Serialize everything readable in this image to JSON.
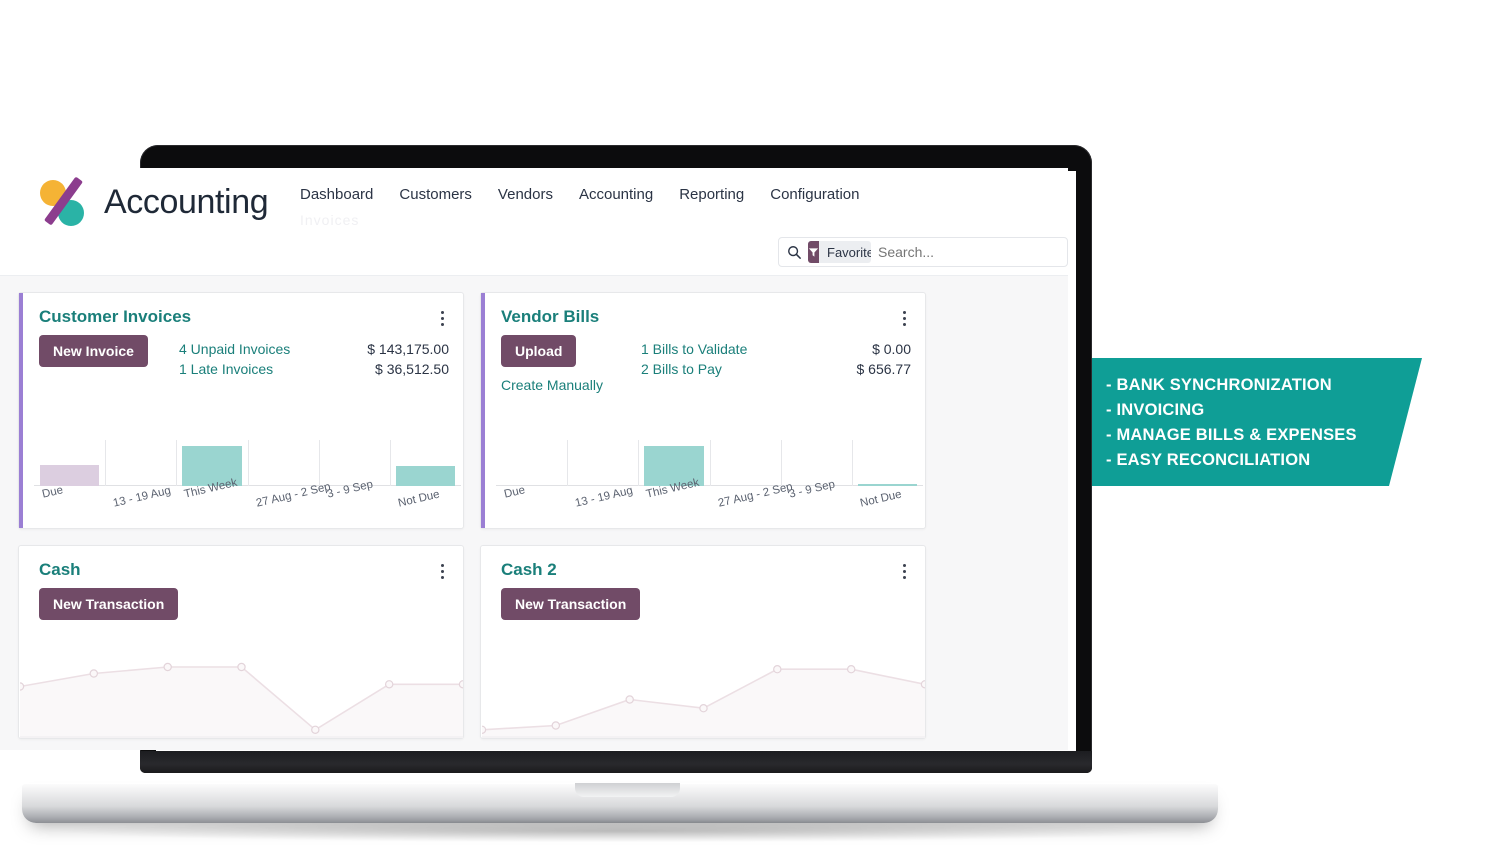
{
  "app": {
    "brand_name": "Accounting",
    "ghost_text": "Invoices",
    "nav": [
      {
        "label": "Dashboard"
      },
      {
        "label": "Customers"
      },
      {
        "label": "Vendors"
      },
      {
        "label": "Accounting"
      },
      {
        "label": "Reporting"
      },
      {
        "label": "Configuration"
      }
    ],
    "search": {
      "facet_label": "Favorites",
      "facet_remove": "×",
      "placeholder": "Search..."
    }
  },
  "cards": {
    "customer_invoices": {
      "title": "Customer Invoices",
      "button": "New Invoice",
      "stats": [
        {
          "label": "4 Unpaid Invoices",
          "value": "$ 143,175.00"
        },
        {
          "label": "1 Late Invoices",
          "value": "$ 36,512.50"
        }
      ]
    },
    "vendor_bills": {
      "title": "Vendor Bills",
      "button": "Upload",
      "secondary_link": "Create Manually",
      "stats": [
        {
          "label": "1 Bills to Validate",
          "value": "$ 0.00"
        },
        {
          "label": "2 Bills to Pay",
          "value": "$ 656.77"
        }
      ]
    },
    "cash": {
      "title": "Cash",
      "button": "New Transaction"
    },
    "cash_2": {
      "title": "Cash 2",
      "button": "New Transaction"
    }
  },
  "banner": {
    "items": [
      "- BANK SYNCHRONIZATION",
      "- INVOICING",
      "- MANAGE BILLS & EXPENSES",
      "- EASY RECONCILIATION"
    ],
    "color": "#0f9e96"
  },
  "colors": {
    "accent_purple": "#714B67",
    "card_border_purple": "#9b7fd4",
    "title_teal": "#1a7f7a",
    "bar_teal": "#9ad5d0",
    "bar_mauve": "#dccee0",
    "line_pink": "#e7dbe0"
  },
  "chart_data": [
    {
      "type": "bar",
      "title": "Customer Invoices",
      "categories": [
        "Due",
        "13 - 19 Aug",
        "This Week",
        "27 Aug - 2 Sep",
        "3 - 9 Sep",
        "Not Due"
      ],
      "values": [
        14,
        0,
        26,
        0,
        0,
        13
      ],
      "colors": [
        "#dccee0",
        null,
        "#9ad5d0",
        null,
        null,
        "#9ad5d0"
      ],
      "xlabel": "",
      "ylabel": "",
      "ylim": [
        0,
        30
      ],
      "grid": true,
      "legend": false
    },
    {
      "type": "bar",
      "title": "Vendor Bills",
      "categories": [
        "Due",
        "13 - 19 Aug",
        "This Week",
        "27 Aug - 2 Sep",
        "3 - 9 Sep",
        "Not Due"
      ],
      "values": [
        0,
        0,
        26,
        0,
        0,
        1
      ],
      "colors": [
        null,
        null,
        "#9ad5d0",
        null,
        null,
        "#9ad5d0"
      ],
      "xlabel": "",
      "ylabel": "",
      "ylim": [
        0,
        30
      ],
      "grid": true,
      "legend": false
    },
    {
      "type": "area",
      "title": "Cash",
      "x": [
        0,
        1,
        2,
        3,
        4,
        5,
        6
      ],
      "values": [
        42,
        54,
        60,
        60,
        2,
        44,
        44
      ],
      "xlabel": "",
      "ylabel": "",
      "ylim": [
        0,
        72
      ],
      "grid": false,
      "legend": false
    },
    {
      "type": "area",
      "title": "Cash 2",
      "x": [
        0,
        1,
        2,
        3,
        4,
        5,
        6
      ],
      "values": [
        2,
        6,
        30,
        22,
        58,
        58,
        44
      ],
      "xlabel": "",
      "ylabel": "",
      "ylim": [
        0,
        72
      ],
      "grid": false,
      "legend": false
    }
  ]
}
